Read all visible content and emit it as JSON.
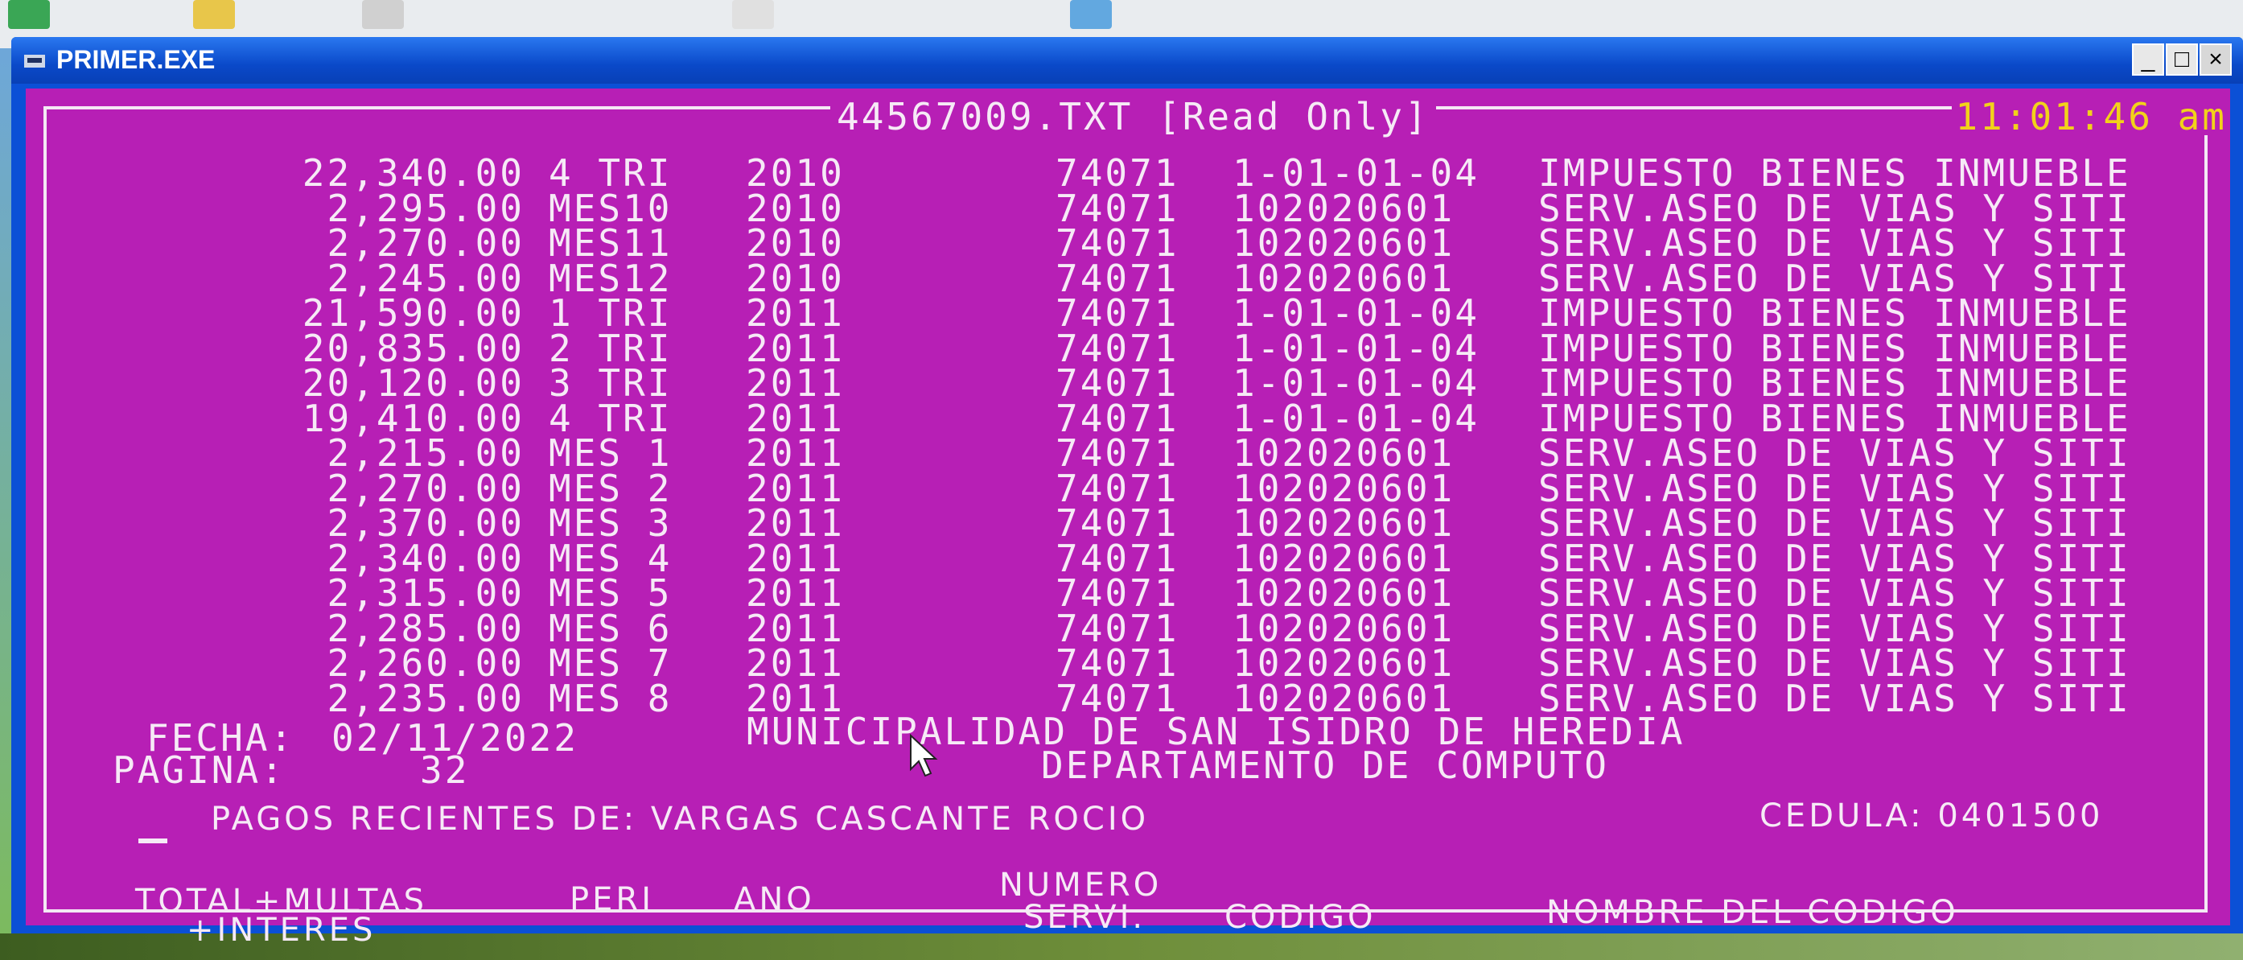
{
  "window": {
    "title": "PRIMER.EXE",
    "controls": [
      "_",
      "□",
      "×"
    ]
  },
  "screen": {
    "file_title": "44567009.TXT [Read Only]",
    "clock": "11:01:46 am",
    "rows": [
      {
        "total": "22,340.00",
        "peri": "4 TRI",
        "ano": "2010",
        "numero": "74071",
        "codigo": "1-01-01-04",
        "nombre": "IMPUESTO BIENES INMUEBLE"
      },
      {
        "total": "2,295.00",
        "peri": "MES10",
        "ano": "2010",
        "numero": "74071",
        "codigo": "102020601",
        "nombre": "SERV.ASEO DE VIAS Y SITI"
      },
      {
        "total": "2,270.00",
        "peri": "MES11",
        "ano": "2010",
        "numero": "74071",
        "codigo": "102020601",
        "nombre": "SERV.ASEO DE VIAS Y SITI"
      },
      {
        "total": "2,245.00",
        "peri": "MES12",
        "ano": "2010",
        "numero": "74071",
        "codigo": "102020601",
        "nombre": "SERV.ASEO DE VIAS Y SITI"
      },
      {
        "total": "21,590.00",
        "peri": "1 TRI",
        "ano": "2011",
        "numero": "74071",
        "codigo": "1-01-01-04",
        "nombre": "IMPUESTO BIENES INMUEBLE"
      },
      {
        "total": "20,835.00",
        "peri": "2 TRI",
        "ano": "2011",
        "numero": "74071",
        "codigo": "1-01-01-04",
        "nombre": "IMPUESTO BIENES INMUEBLE"
      },
      {
        "total": "20,120.00",
        "peri": "3 TRI",
        "ano": "2011",
        "numero": "74071",
        "codigo": "1-01-01-04",
        "nombre": "IMPUESTO BIENES INMUEBLE"
      },
      {
        "total": "19,410.00",
        "peri": "4 TRI",
        "ano": "2011",
        "numero": "74071",
        "codigo": "1-01-01-04",
        "nombre": "IMPUESTO BIENES INMUEBLE"
      },
      {
        "total": "2,215.00",
        "peri": "MES 1",
        "ano": "2011",
        "numero": "74071",
        "codigo": "102020601",
        "nombre": "SERV.ASEO DE VIAS Y SITI"
      },
      {
        "total": "2,270.00",
        "peri": "MES 2",
        "ano": "2011",
        "numero": "74071",
        "codigo": "102020601",
        "nombre": "SERV.ASEO DE VIAS Y SITI"
      },
      {
        "total": "2,370.00",
        "peri": "MES 3",
        "ano": "2011",
        "numero": "74071",
        "codigo": "102020601",
        "nombre": "SERV.ASEO DE VIAS Y SITI"
      },
      {
        "total": "2,340.00",
        "peri": "MES 4",
        "ano": "2011",
        "numero": "74071",
        "codigo": "102020601",
        "nombre": "SERV.ASEO DE VIAS Y SITI"
      },
      {
        "total": "2,315.00",
        "peri": "MES 5",
        "ano": "2011",
        "numero": "74071",
        "codigo": "102020601",
        "nombre": "SERV.ASEO DE VIAS Y SITI"
      },
      {
        "total": "2,285.00",
        "peri": "MES 6",
        "ano": "2011",
        "numero": "74071",
        "codigo": "102020601",
        "nombre": "SERV.ASEO DE VIAS Y SITI"
      },
      {
        "total": "2,260.00",
        "peri": "MES 7",
        "ano": "2011",
        "numero": "74071",
        "codigo": "102020601",
        "nombre": "SERV.ASEO DE VIAS Y SITI"
      },
      {
        "total": "2,235.00",
        "peri": "MES 8",
        "ano": "2011",
        "numero": "74071",
        "codigo": "102020601",
        "nombre": "SERV.ASEO DE VIAS Y SITI"
      }
    ],
    "fecha_label": "FECHA:",
    "fecha_value": "02/11/2022",
    "pagina_label": "PAGINA:",
    "pagina_value": "32",
    "org_name": "MUNICIPALIDAD DE SAN ISIDRO DE HEREDIA",
    "org_dept": "DEPARTAMENTO DE COMPUTO",
    "pagos_line": "PAGOS RECIENTES DE: VARGAS CASCANTE ROCIO",
    "cedula_line": "CEDULA: 0401500",
    "headers": {
      "total_1": "TOTAL+MULTAS",
      "total_2": "+INTERES",
      "peri": "PERI",
      "ano": "ANO",
      "numero_1": "NUMERO",
      "numero_2": "SERVI.",
      "codigo": "CODIGO",
      "nombre": "NOMBRE DEL CODIGO"
    }
  },
  "colors": {
    "console_bg": "#b71fb5",
    "console_text": "#f6eaf6",
    "clock_text": "#f2d21a",
    "titlebar": "#0a49c9"
  }
}
